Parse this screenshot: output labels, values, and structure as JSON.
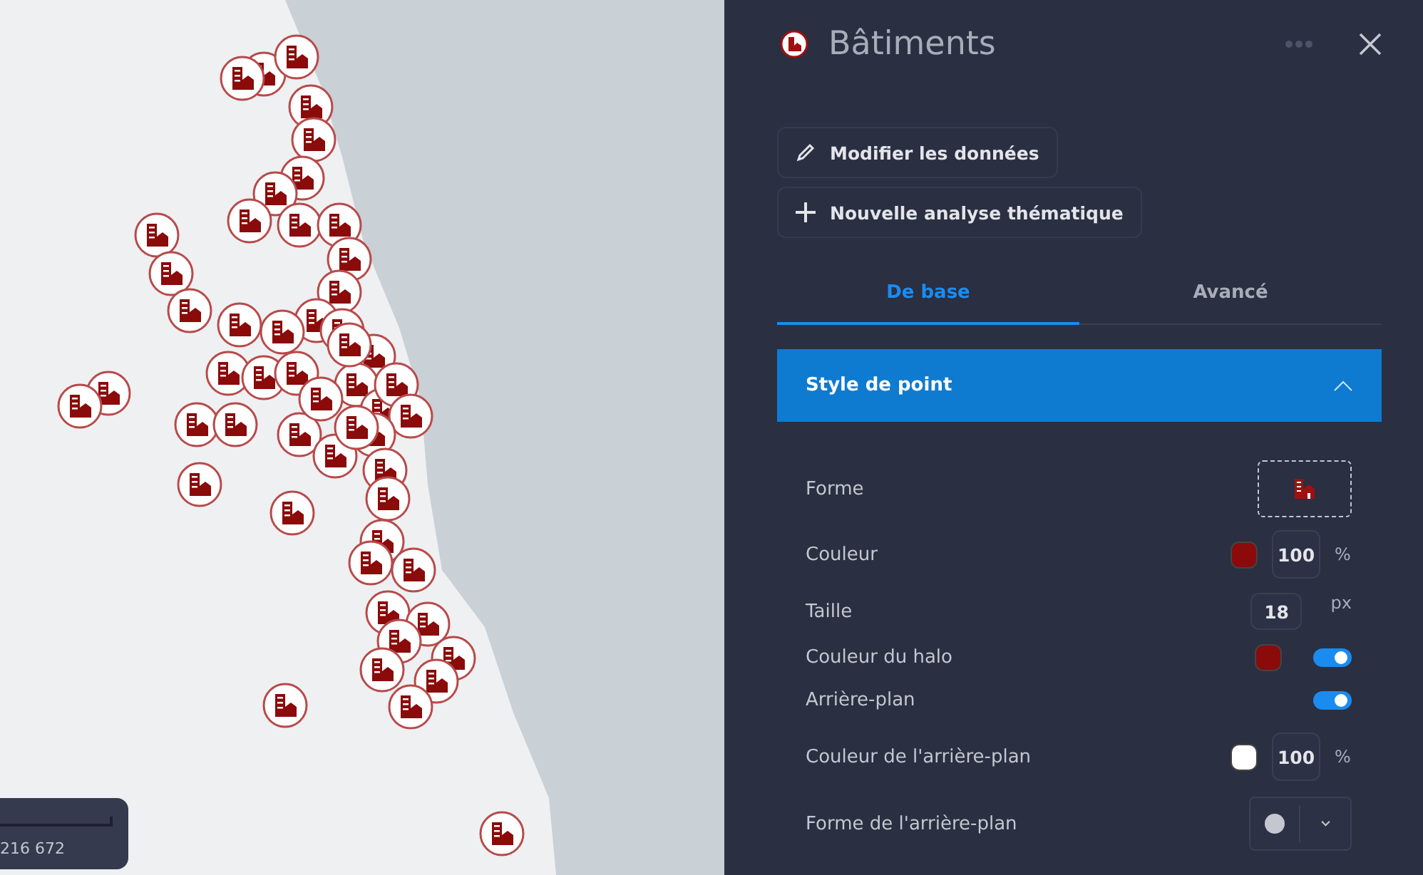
{
  "map": {
    "scale_label": "216 672"
  },
  "panel": {
    "title": "Bâtiments",
    "actions": [
      {
        "kind": "edit",
        "label": "Modifier les données"
      },
      {
        "kind": "add",
        "label": "Nouvelle analyse thématique"
      }
    ],
    "tabs": [
      {
        "label": "De base",
        "selected": true
      },
      {
        "label": "Avancé",
        "selected": false
      }
    ],
    "section": {
      "title": "Style de point",
      "expanded": true
    },
    "properties": [
      {
        "kind": "shape",
        "label": "Forme"
      },
      {
        "kind": "color_opacity",
        "label": "Couleur",
        "color": "#8b0a0a",
        "value": "100",
        "unit": "%"
      },
      {
        "kind": "number",
        "label": "Taille",
        "value": "18",
        "unit": "px"
      },
      {
        "kind": "color_toggle",
        "label": "Couleur du halo",
        "color": "#8b0a0a",
        "on": true
      },
      {
        "kind": "toggle",
        "label": "Arrière-plan",
        "on": true
      },
      {
        "kind": "color_opacity",
        "label": "Couleur de l'arrière-plan",
        "color": "#ffffff",
        "value": "100",
        "unit": "%"
      },
      {
        "kind": "select",
        "label": "Forme de l'arrière-plan"
      }
    ]
  }
}
